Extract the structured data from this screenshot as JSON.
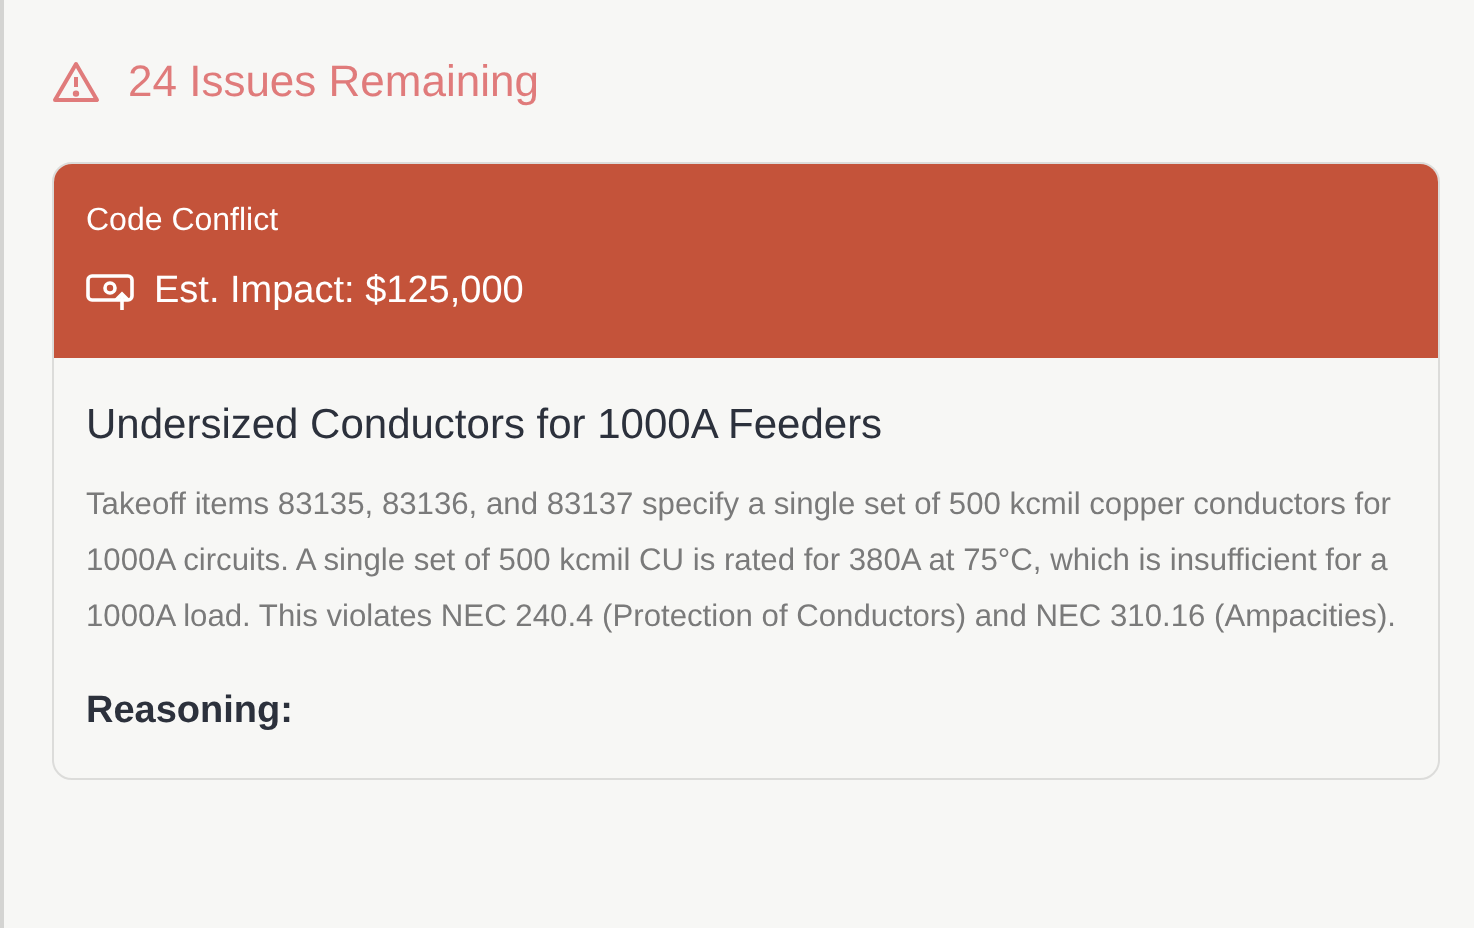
{
  "status": {
    "text": "24 Issues Remaining"
  },
  "issue": {
    "category": "Code Conflict",
    "impact": "Est. Impact: $125,000",
    "title": "Undersized Conductors for 1000A Feeders",
    "description": "Takeoff items 83135, 83136, and 83137 specify a single set of 500 kcmil copper conductors for 1000A circuits. A single set of 500 kcmil CU is rated for 380A at 75°C, which is insufficient for a 1000A load. This violates NEC 240.4 (Protection of Conductors) and NEC 310.16 (Ampacities).",
    "section_heading": "Reasoning:"
  }
}
